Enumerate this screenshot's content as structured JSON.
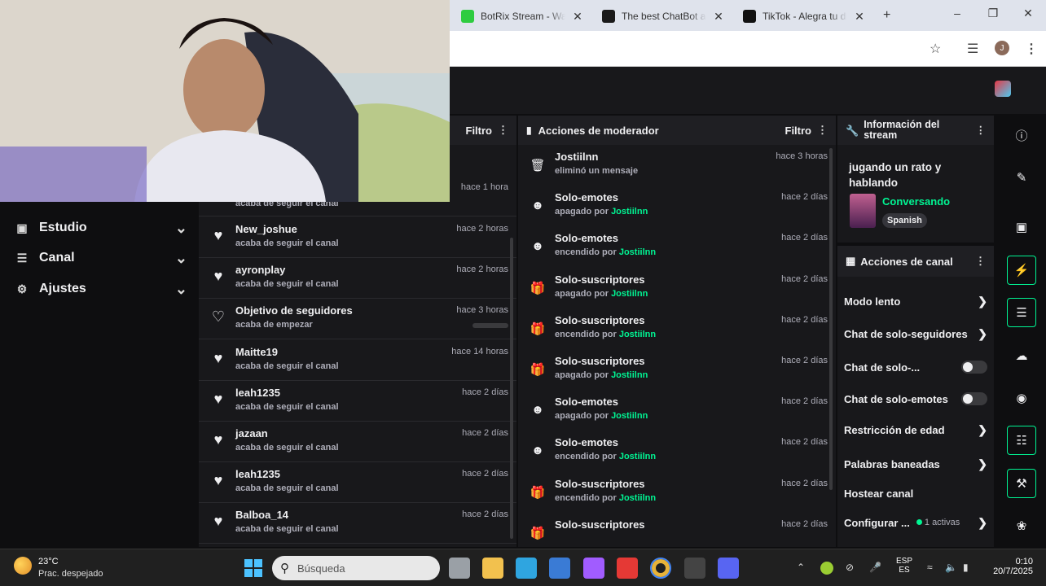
{
  "browser": {
    "tabs": [
      {
        "title": "BotRix Stream - Watch",
        "color": "#2ecc40"
      },
      {
        "title": "The best ChatBot and",
        "color": "#1a1a1a"
      },
      {
        "title": "TikTok - Alegra tu día",
        "color": "#111111"
      }
    ],
    "new_tab": "+",
    "avatar_letter": "J"
  },
  "sidebar": {
    "items": [
      {
        "label": "Estudio",
        "icon": "studio-icon"
      },
      {
        "label": "Canal",
        "icon": "channel-icon"
      },
      {
        "label": "Ajustes",
        "icon": "gear-icon"
      }
    ]
  },
  "activity_panel": {
    "filter_label": "Filtro",
    "top_time": "hace 1 hora",
    "top_sub": "acaba de seguir el canal",
    "rows": [
      {
        "title": "New_joshue",
        "sub": "acaba de seguir el canal",
        "time": "hace 2 horas",
        "icon": "heart-icon"
      },
      {
        "title": "ayronplay",
        "sub": "acaba de seguir el canal",
        "time": "hace 2 horas",
        "icon": "heart-icon"
      },
      {
        "title": "Objetivo de seguidores",
        "sub": "acaba de empezar",
        "time": "hace 3 horas",
        "icon": "heart-outline-icon"
      },
      {
        "title": "Maitte19",
        "sub": "acaba de seguir el canal",
        "time": "hace 14 horas",
        "icon": "heart-icon"
      },
      {
        "title": "leah1235",
        "sub": "acaba de seguir el canal",
        "time": "hace 2 días",
        "icon": "heart-icon"
      },
      {
        "title": "jazaan",
        "sub": "acaba de seguir el canal",
        "time": "hace 2 días",
        "icon": "heart-icon"
      },
      {
        "title": "leah1235",
        "sub": "acaba de seguir el canal",
        "time": "hace 2 días",
        "icon": "heart-icon"
      },
      {
        "title": "Balboa_14",
        "sub": "acaba de seguir el canal",
        "time": "hace 2 días",
        "icon": "heart-icon"
      }
    ]
  },
  "mod_panel": {
    "title": "Acciones de moderador",
    "filter_label": "Filtro",
    "rows": [
      {
        "title": "Jostiilnn",
        "pre": "eliminó un mensaje",
        "user": "",
        "time": "hace 3 horas",
        "icon": "trash-icon"
      },
      {
        "title": "Solo-emotes",
        "pre": "apagado por ",
        "user": "Jostiilnn",
        "time": "hace 2 días",
        "icon": "emote-icon"
      },
      {
        "title": "Solo-emotes",
        "pre": "encendido por ",
        "user": "Jostiilnn",
        "time": "hace 2 días",
        "icon": "emote-icon"
      },
      {
        "title": "Solo-suscriptores",
        "pre": "apagado por ",
        "user": "Jostiilnn",
        "time": "hace 2 días",
        "icon": "gift-icon"
      },
      {
        "title": "Solo-suscriptores",
        "pre": "encendido por ",
        "user": "Jostiilnn",
        "time": "hace 2 días",
        "icon": "gift-icon"
      },
      {
        "title": "Solo-suscriptores",
        "pre": "apagado por ",
        "user": "Jostiilnn",
        "time": "hace 2 días",
        "icon": "gift-icon"
      },
      {
        "title": "Solo-emotes",
        "pre": "apagado por ",
        "user": "Jostiilnn",
        "time": "hace 2 días",
        "icon": "emote-icon"
      },
      {
        "title": "Solo-emotes",
        "pre": "encendido por ",
        "user": "Jostiilnn",
        "time": "hace 2 días",
        "icon": "emote-icon"
      },
      {
        "title": "Solo-suscriptores",
        "pre": "encendido por ",
        "user": "Jostiilnn",
        "time": "hace 2 días",
        "icon": "gift-icon"
      },
      {
        "title": "Solo-suscriptores",
        "pre": "",
        "user": "",
        "time": "hace 2 días",
        "icon": "gift-icon"
      }
    ]
  },
  "stream_info": {
    "title": "Información del stream",
    "stream_title": "jugando un rato y hablando",
    "category": "Conversando",
    "language": "Spanish"
  },
  "channel_actions": {
    "title": "Acciones de canal",
    "items": [
      {
        "label": "Modo lento",
        "control": "chevron"
      },
      {
        "label": "Chat de solo-seguidores",
        "control": "chevron"
      },
      {
        "label": "Chat de solo-...",
        "control": "toggle"
      },
      {
        "label": "Chat de solo-emotes",
        "control": "toggle"
      },
      {
        "label": "Restricción de edad",
        "control": "chevron"
      },
      {
        "label": "Palabras baneadas",
        "control": "chevron"
      },
      {
        "label": "Hostear canal",
        "control": "none"
      },
      {
        "label": "Configurar ...",
        "control": "chevron",
        "badge": "1 activas"
      }
    ]
  },
  "taskbar": {
    "weather_temp": "23°C",
    "weather_desc": "Prac. despejado",
    "search_placeholder": "Búsqueda",
    "lang_line1": "ESP",
    "lang_line2": "ES",
    "time": "0:10",
    "date": "20/7/2025"
  }
}
